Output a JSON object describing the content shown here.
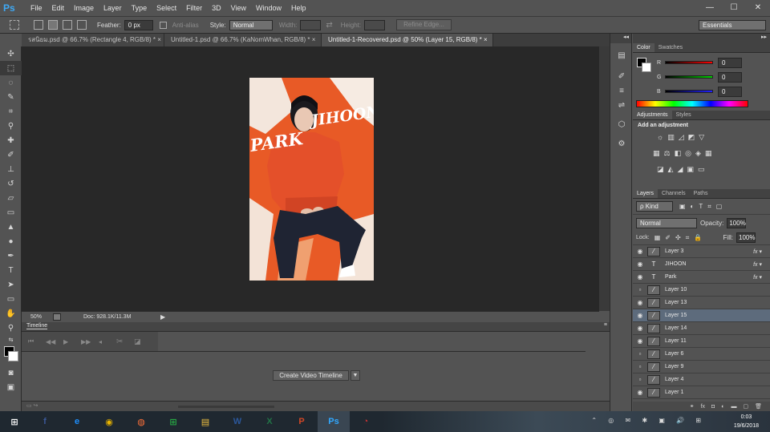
{
  "app": {
    "logo": "Ps"
  },
  "menu": [
    "File",
    "Edit",
    "Image",
    "Layer",
    "Type",
    "Select",
    "Filter",
    "3D",
    "View",
    "Window",
    "Help"
  ],
  "window_controls": {
    "minimize": "—",
    "maximize": "☐",
    "close": "✕"
  },
  "options": {
    "feather_label": "Feather:",
    "feather_value": "0 px",
    "antialias_label": "Anti-alias",
    "style_label": "Style:",
    "style_value": "Normal",
    "width_label": "Width:",
    "height_label": "Height:",
    "refine_edge": "Refine Edge...",
    "workspace": "Essentials"
  },
  "tabs": [
    {
      "label": "รสนิยม.psd @ 66.7% (Rectangle 4, RGB/8) *"
    },
    {
      "label": "Untitled-1.psd @ 66.7% (KaNomWhan, RGB/8) *"
    },
    {
      "label": "Untitled-1-Recovered.psd @ 50% (Layer 15, RGB/8) *"
    }
  ],
  "artwork": {
    "text1": "PARK",
    "text2": "JIHOON"
  },
  "status": {
    "zoom": "50%",
    "doc": "Doc: 928.1K/11.3M"
  },
  "timeline": {
    "title": "Timeline",
    "create_button": "Create Video Timeline"
  },
  "color_panel": {
    "tabs": [
      "Color",
      "Swatches"
    ],
    "channels": [
      {
        "label": "R",
        "value": "0"
      },
      {
        "label": "G",
        "value": "0"
      },
      {
        "label": "B",
        "value": "0"
      }
    ]
  },
  "adjustments_panel": {
    "tabs": [
      "Adjustments",
      "Styles"
    ],
    "heading": "Add an adjustment"
  },
  "layers_panel": {
    "tabs": [
      "Layers",
      "Channels",
      "Paths"
    ],
    "filter": "ρ Kind",
    "blend_mode": "Normal",
    "opacity_label": "Opacity:",
    "opacity_value": "100%",
    "lock_label": "Lock:",
    "fill_label": "Fill:",
    "fill_value": "100%",
    "layers": [
      {
        "name": "Layer 3",
        "type": "brush",
        "visible": true,
        "fx": true,
        "selected": false
      },
      {
        "name": "JIHOON",
        "type": "text",
        "visible": true,
        "fx": true,
        "selected": false
      },
      {
        "name": "Park",
        "type": "text",
        "visible": true,
        "fx": true,
        "selected": false
      },
      {
        "name": "Layer 10",
        "type": "brush",
        "visible": false,
        "fx": false,
        "selected": false
      },
      {
        "name": "Layer 13",
        "type": "brush",
        "visible": true,
        "fx": false,
        "selected": false
      },
      {
        "name": "Layer 15",
        "type": "brush",
        "visible": true,
        "fx": false,
        "selected": true
      },
      {
        "name": "Layer 14",
        "type": "brush",
        "visible": true,
        "fx": false,
        "selected": false
      },
      {
        "name": "Layer 11",
        "type": "brush",
        "visible": true,
        "fx": false,
        "selected": false
      },
      {
        "name": "Layer 6",
        "type": "brush",
        "visible": false,
        "fx": false,
        "selected": false
      },
      {
        "name": "Layer 9",
        "type": "brush",
        "visible": false,
        "fx": false,
        "selected": false
      },
      {
        "name": "Layer 4",
        "type": "brush",
        "visible": false,
        "fx": false,
        "selected": false
      },
      {
        "name": "Layer 1",
        "type": "brush",
        "visible": true,
        "fx": false,
        "selected": false
      }
    ]
  },
  "taskbar": {
    "apps": [
      {
        "name": "start",
        "glyph": "⊞",
        "color": "#ffffff"
      },
      {
        "name": "facebook",
        "glyph": "f",
        "color": "#3b5998"
      },
      {
        "name": "edge",
        "glyph": "e",
        "color": "#1e90ff"
      },
      {
        "name": "chrome",
        "glyph": "◉",
        "color": "#e8b400"
      },
      {
        "name": "firefox",
        "glyph": "◍",
        "color": "#ff7139"
      },
      {
        "name": "store",
        "glyph": "⊞",
        "color": "#27a844"
      },
      {
        "name": "explorer",
        "glyph": "▤",
        "color": "#f0c040"
      },
      {
        "name": "word",
        "glyph": "W",
        "color": "#2b579a"
      },
      {
        "name": "excel",
        "glyph": "X",
        "color": "#217346"
      },
      {
        "name": "powerpoint",
        "glyph": "P",
        "color": "#d24726"
      },
      {
        "name": "photoshop",
        "glyph": "Ps",
        "color": "#31a8ff"
      },
      {
        "name": "other",
        "glyph": "◔",
        "color": "#cc3333"
      }
    ],
    "time": "0:03",
    "date": "19/6/2018"
  }
}
